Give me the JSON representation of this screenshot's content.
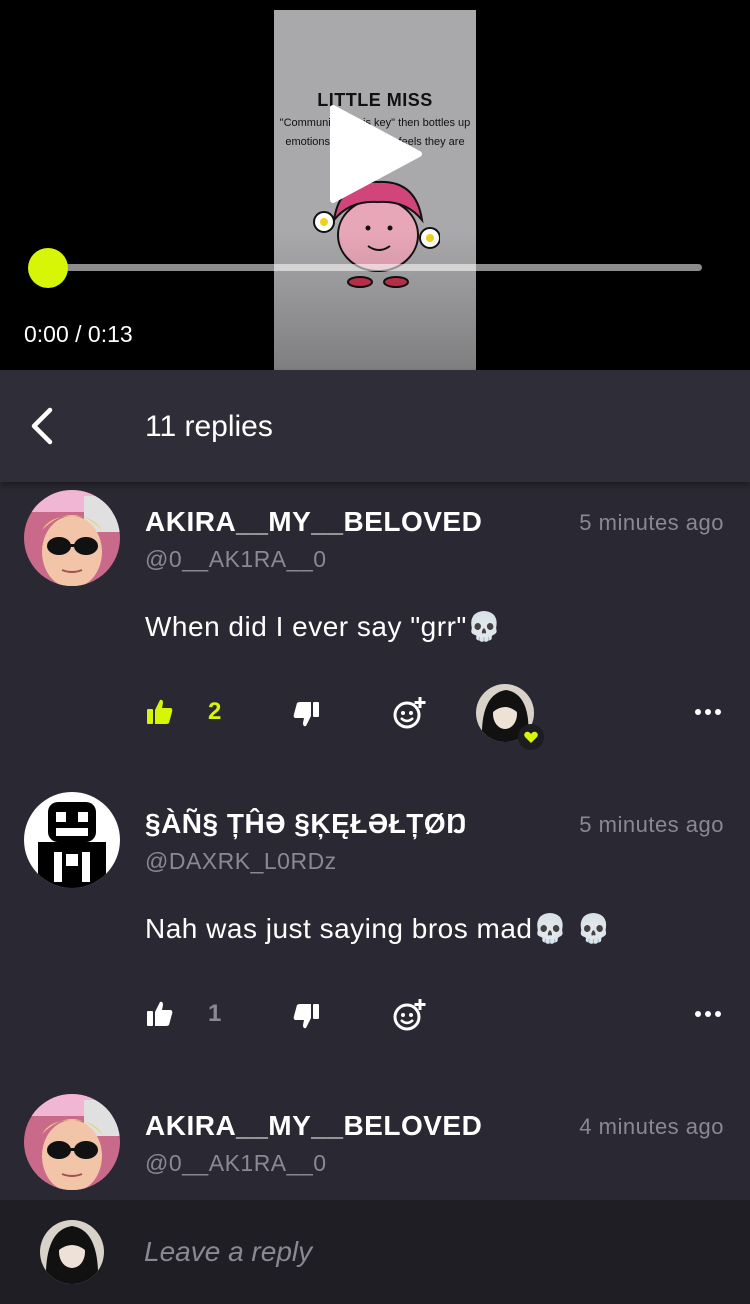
{
  "video": {
    "thumbnail_title": "LITTLE MISS",
    "thumbnail_caption": "\"Communication is key\" then bottles up emotions because she feels they are invalid",
    "time": "0:00 / 0:13",
    "progress": 0,
    "accent_color": "#d6f507"
  },
  "thread": {
    "back_icon": "chevron-left-icon",
    "title": "11 replies"
  },
  "comments": [
    {
      "name": "AKIRA__MY__BELOVED",
      "handle": "@0__AK1RA__0",
      "time": "5 minutes ago",
      "text": "When did I ever say \"grr\"💀",
      "likes": "2",
      "liked": true,
      "reaction": "heart"
    },
    {
      "name": "§ÀÑ§ ȚĤƏ §ĶĘŁƏŁȚØŊ",
      "handle": "@DAXRK_L0RDz",
      "time": "5 minutes ago",
      "text": "Nah was just saying bros mad💀 💀",
      "likes": "1",
      "liked": false
    },
    {
      "name": "AKIRA__MY__BELOVED",
      "handle": "@0__AK1RA__0",
      "time": "4 minutes ago"
    }
  ],
  "composer": {
    "placeholder": "Leave a reply"
  }
}
